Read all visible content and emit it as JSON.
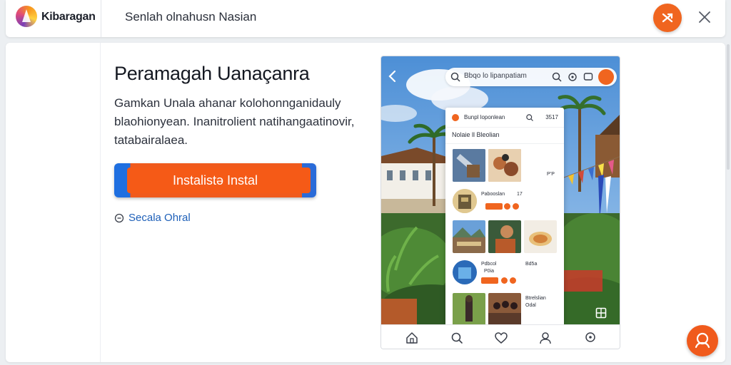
{
  "header": {
    "logo_text": "Kibaragan",
    "title": "Senlah olnahusn Nasian"
  },
  "main": {
    "headline": "Peramagah Uanaçanra",
    "description_lines": [
      "Gamkan Unala ahanar kolohonnganidauly",
      "blaohionyean. Inanitrolient natihangaatinovir,",
      "tatabairalaea."
    ],
    "install_label": "Instalistə Instal",
    "secondary_link": "Secala Ohral"
  },
  "phone": {
    "search_text": "Bbqo lo lipanpatiam",
    "panel_title": "Bunpl loponlean",
    "panel_count": "3517",
    "panel_subtitle": "Nolaie ll Bleolian",
    "row1_side": "P’P",
    "row2_label": "Pabooslan",
    "row2_num": "17",
    "row4_label1": "Pdbcol",
    "row4_label2": "P0ia",
    "row4_side": "Bd5a",
    "row5_label1": "Btrelslian",
    "row5_label2": "Odal"
  },
  "colors": {
    "accent": "#f0651f",
    "link": "#1d5fb8"
  },
  "icons": [
    "logo-icon",
    "close-icon",
    "back-icon",
    "search-icon",
    "home-icon",
    "heart-icon",
    "user-icon",
    "compass-icon",
    "chat-icon"
  ]
}
